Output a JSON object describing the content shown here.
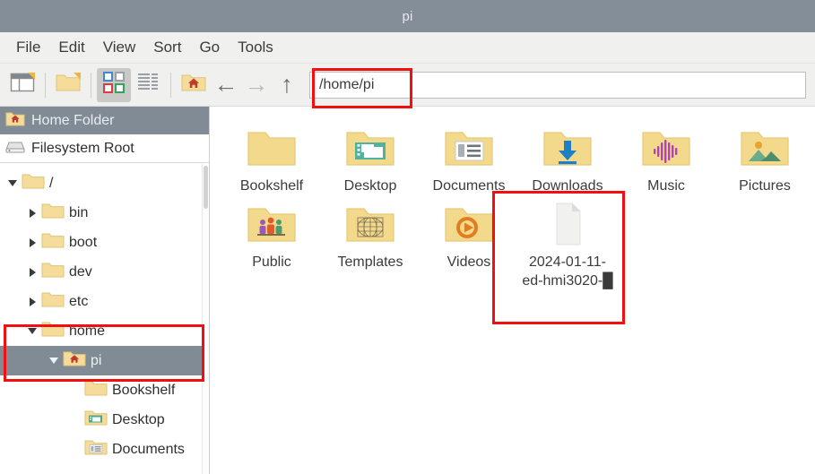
{
  "window": {
    "title": "pi"
  },
  "menubar": {
    "items": [
      {
        "label": "File"
      },
      {
        "label": "Edit"
      },
      {
        "label": "View"
      },
      {
        "label": "Sort"
      },
      {
        "label": "Go"
      },
      {
        "label": "Tools"
      }
    ]
  },
  "toolbar": {
    "buttons": [
      {
        "name": "new-tab-icon",
        "title": "New Tab"
      },
      {
        "name": "new-folder-icon",
        "title": "New Folder"
      },
      {
        "name": "icon-view-icon",
        "title": "Icon View"
      },
      {
        "name": "list-view-icon",
        "title": "List View"
      },
      {
        "name": "home-folder-icon",
        "title": "Home"
      }
    ],
    "nav": {
      "back": "←",
      "forward": "→",
      "up": "↑"
    },
    "path_value": "/home/pi",
    "path_placeholder": "/home/pi"
  },
  "sidebar": {
    "places": [
      {
        "label": "Home Folder",
        "icon": "home-folder-icon",
        "selected": true
      },
      {
        "label": "Filesystem Root",
        "icon": "drive-icon",
        "selected": false
      }
    ],
    "tree": [
      {
        "label": "/",
        "indent": 0,
        "twisty": "down",
        "icon": "folder-icon",
        "selected": false
      },
      {
        "label": "bin",
        "indent": 1,
        "twisty": "right",
        "icon": "folder-icon",
        "selected": false
      },
      {
        "label": "boot",
        "indent": 1,
        "twisty": "right",
        "icon": "folder-icon",
        "selected": false
      },
      {
        "label": "dev",
        "indent": 1,
        "twisty": "right",
        "icon": "folder-icon",
        "selected": false
      },
      {
        "label": "etc",
        "indent": 1,
        "twisty": "right",
        "icon": "folder-icon",
        "selected": false
      },
      {
        "label": "home",
        "indent": 1,
        "twisty": "down",
        "icon": "folder-icon",
        "selected": false
      },
      {
        "label": "pi",
        "indent": 2,
        "twisty": "down",
        "icon": "home-folder-icon",
        "selected": true
      },
      {
        "label": "Bookshelf",
        "indent": 3,
        "twisty": "none",
        "icon": "folder-icon",
        "selected": false
      },
      {
        "label": "Desktop",
        "indent": 3,
        "twisty": "none",
        "icon": "desktop-folder-icon",
        "selected": false
      },
      {
        "label": "Documents",
        "indent": 3,
        "twisty": "none",
        "icon": "documents-folder-icon",
        "selected": false
      }
    ]
  },
  "files": {
    "items": [
      {
        "name": "Bookshelf",
        "icon": "folder-icon",
        "type": "folder"
      },
      {
        "name": "Desktop",
        "icon": "desktop-folder-icon",
        "type": "folder"
      },
      {
        "name": "Documents",
        "icon": "documents-folder-icon",
        "type": "folder"
      },
      {
        "name": "Downloads",
        "icon": "downloads-folder-icon",
        "type": "folder"
      },
      {
        "name": "Music",
        "icon": "music-folder-icon",
        "type": "folder"
      },
      {
        "name": "Pictures",
        "icon": "pictures-folder-icon",
        "type": "folder"
      },
      {
        "name": "Public",
        "icon": "public-folder-icon",
        "type": "folder"
      },
      {
        "name": "Templates",
        "icon": "templates-folder-icon",
        "type": "folder"
      },
      {
        "name": "Videos",
        "icon": "videos-folder-icon",
        "type": "folder"
      },
      {
        "name": "2024-01-11-ed-hmi3020-█",
        "icon": "document-file-icon",
        "type": "file"
      }
    ]
  },
  "colors": {
    "titlebar": "#848e98",
    "chrome": "#f0f0ef",
    "selection": "#808b95",
    "folder": "#f3d98b",
    "annotation": "#f20f0f",
    "text": "#3b3b3b"
  }
}
